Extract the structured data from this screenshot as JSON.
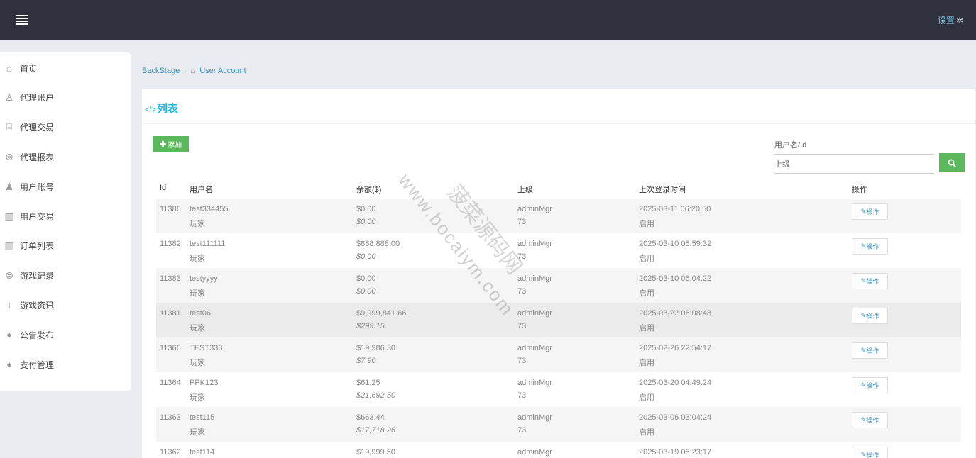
{
  "header": {
    "settings_label": "设置",
    "settings_icon": "gear-icon"
  },
  "sidebar": {
    "items": [
      {
        "label": "首页",
        "icon": "home-icon",
        "glyph": "⌂"
      },
      {
        "label": "代理账户",
        "icon": "user-lock-icon",
        "glyph": "♙"
      },
      {
        "label": "代理交易",
        "icon": "bank-icon",
        "glyph": "⌸"
      },
      {
        "label": "代理报表",
        "icon": "lifebuoy-icon",
        "glyph": "⊛"
      },
      {
        "label": "用户账号",
        "icon": "user-icon",
        "glyph": "♟"
      },
      {
        "label": "用户交易",
        "icon": "briefcase-icon",
        "glyph": "▥"
      },
      {
        "label": "订单列表",
        "icon": "briefcase-icon",
        "glyph": "▥"
      },
      {
        "label": "游戏记录",
        "icon": "gamepad-icon",
        "glyph": "⊜"
      },
      {
        "label": "游戏资讯",
        "icon": "info-icon",
        "glyph": "ⅰ"
      },
      {
        "label": "公告发布",
        "icon": "bell-icon",
        "glyph": "♦"
      },
      {
        "label": "支付管理",
        "icon": "bell-icon",
        "glyph": "♦"
      }
    ]
  },
  "breadcrumb": {
    "root": "BackStage",
    "current": "User Account"
  },
  "panel": {
    "title_code": "</>",
    "title": "列表",
    "add_label": "添加",
    "search_user_placeholder": "用户名/Id",
    "search_parent_placeholder": "上级"
  },
  "table": {
    "headers": [
      "Id",
      "用户名",
      "余额($)",
      "上级",
      "上次登录时间",
      "操作"
    ],
    "op_label": "操作",
    "rows": [
      {
        "id": "11386",
        "username": "test334455",
        "role": "玩家",
        "balance": "$0.00",
        "balance2": "$0.00",
        "parent": "adminMgr",
        "parent_id": "73",
        "last_login": "2025-03-11 06:20:50",
        "status": "启用"
      },
      {
        "id": "11382",
        "username": "test111111",
        "role": "玩家",
        "balance": "$888,888.00",
        "balance2": "$0.00",
        "parent": "adminMgr",
        "parent_id": "73",
        "last_login": "2025-03-10 05:59:32",
        "status": "启用"
      },
      {
        "id": "11383",
        "username": "testyyyy",
        "role": "玩家",
        "balance": "$0.00",
        "balance2": "$0.00",
        "parent": "adminMgr",
        "parent_id": "73",
        "last_login": "2025-03-10 06:04:22",
        "status": "启用"
      },
      {
        "id": "11381",
        "username": "test06",
        "role": "玩家",
        "balance": "$9,999,841.66",
        "balance2": "$299.15",
        "parent": "adminMgr",
        "parent_id": "73",
        "last_login": "2025-03-22 06:08:48",
        "status": "启用"
      },
      {
        "id": "11366",
        "username": "TEST333",
        "role": "玩家",
        "balance": "$19,986.30",
        "balance2": "$7.90",
        "parent": "adminMgr",
        "parent_id": "73",
        "last_login": "2025-02-26 22:54:17",
        "status": "启用"
      },
      {
        "id": "11364",
        "username": "PPK123",
        "role": "玩家",
        "balance": "$61.25",
        "balance2": "$21,692.50",
        "parent": "adminMgr",
        "parent_id": "73",
        "last_login": "2025-03-20 04:49:24",
        "status": "启用"
      },
      {
        "id": "11363",
        "username": "test115",
        "role": "玩家",
        "balance": "$663.44",
        "balance2": "$17,718.26",
        "parent": "adminMgr",
        "parent_id": "73",
        "last_login": "2025-03-06 03:04:24",
        "status": "启用"
      },
      {
        "id": "11362",
        "username": "test114",
        "role": "",
        "balance": "$19,999.50",
        "balance2": "",
        "parent": "adminMgr",
        "parent_id": "",
        "last_login": "2025-03-19 08:23:17",
        "status": ""
      }
    ]
  },
  "watermark": {
    "url": "www.bocaiym.com",
    "text": "菠菜源码网"
  }
}
